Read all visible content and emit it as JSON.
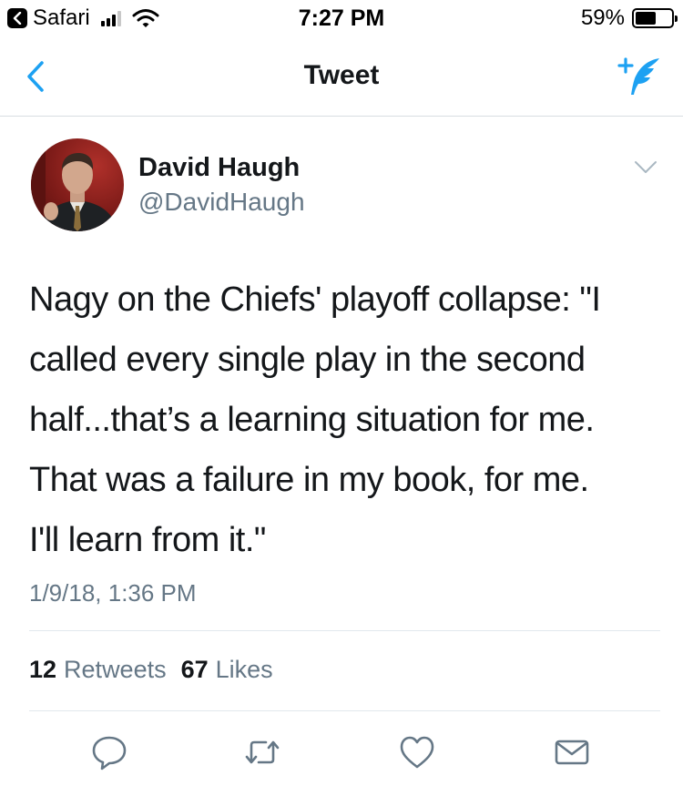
{
  "status_bar": {
    "back_app": "Safari",
    "time": "7:27 PM",
    "battery_percent": "59%",
    "battery_level": 0.59,
    "signal_bars": 3,
    "signal_max": 4
  },
  "nav": {
    "title": "Tweet",
    "back_icon": "chevron-left-icon",
    "compose_icon": "compose-tweet-icon"
  },
  "tweet": {
    "author_name": "David Haugh",
    "author_handle": "@DavidHaugh",
    "text": "Nagy on the Chiefs' playoff collapse: \"I\ncalled every single play  in the second\nhalf...that’s a learning situation for me.\nThat was a failure in my book, for me.\nI'll learn from it.\"",
    "date": "1/9/18, 1:36 PM",
    "retweets_count": "12",
    "retweets_label": "Retweets",
    "likes_count": "67",
    "likes_label": "Likes"
  },
  "actions": [
    "reply-icon",
    "retweet-icon",
    "like-icon",
    "share-icon"
  ],
  "colors": {
    "accent": "#1da1f2",
    "text": "#14171a",
    "secondary": "#657786",
    "divider": "#e1e8ed"
  }
}
